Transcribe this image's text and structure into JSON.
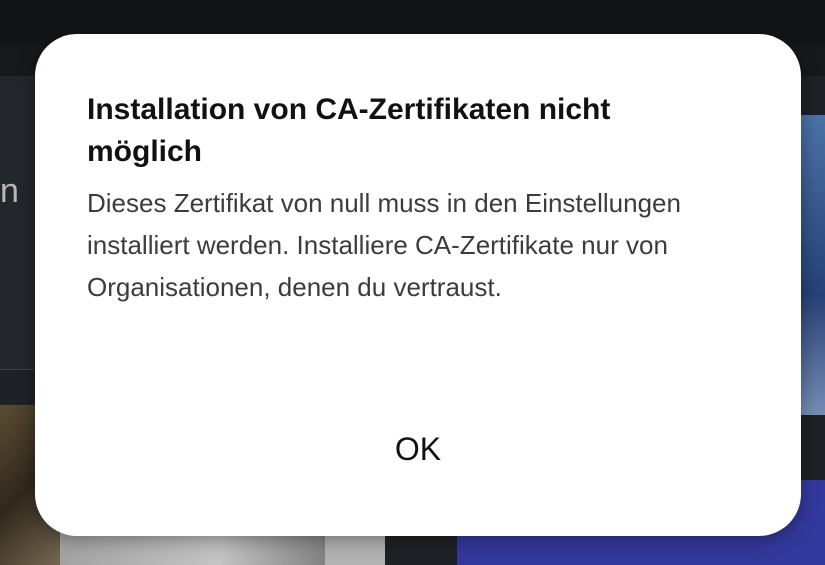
{
  "background": {
    "left_text_fragment": "n"
  },
  "dialog": {
    "title": "Installation von CA-Zertifikaten nicht möglich",
    "message": "Dieses Zertifikat von null muss in den Einstellungen installiert werden. Installiere CA-Zertifikate nur von Organisationen, denen du vertraust.",
    "ok_label": "OK"
  },
  "colors": {
    "dialog_background": "#ffffff",
    "title_text": "#111111",
    "body_text": "#3c3c3c",
    "app_background": "#24272c"
  }
}
